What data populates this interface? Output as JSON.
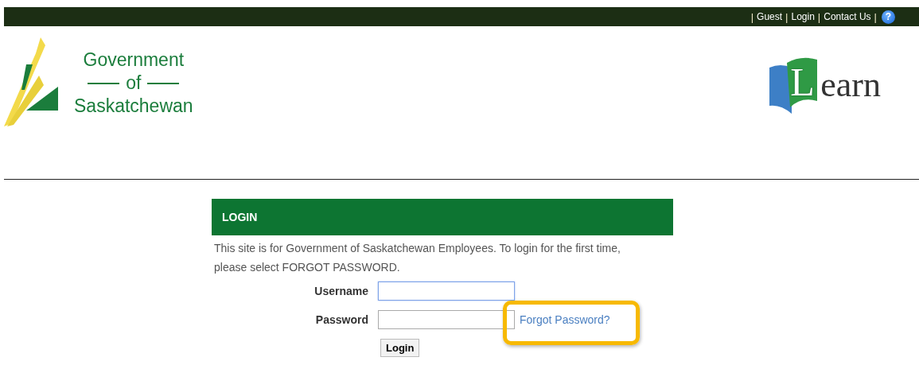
{
  "top_bar": {
    "nav": [
      {
        "kind": "separator",
        "text": "|"
      },
      {
        "kind": "link",
        "text": "Guest"
      },
      {
        "kind": "separator",
        "text": "|"
      },
      {
        "kind": "link",
        "text": "Login"
      },
      {
        "kind": "separator",
        "text": "|"
      },
      {
        "kind": "link",
        "text": "Contact Us"
      },
      {
        "kind": "separator",
        "text": "|"
      },
      {
        "kind": "help",
        "text": "?"
      }
    ]
  },
  "logo": {
    "line_1": "Government",
    "line_2": "of",
    "line_3": "Saskatchewan"
  },
  "learn_logo": {
    "initial": "L",
    "rest": "earn"
  },
  "login_panel": {
    "title": "LOGIN",
    "intro": "This site is for Government of Saskatchewan Employees. To login for the first time, please select FORGOT PASSWORD.",
    "fields": [
      {
        "label": "Username",
        "focused": true
      },
      {
        "label": "Password",
        "focused": false,
        "link": "Forgot Password?"
      }
    ],
    "button": "Login",
    "highlight": true
  }
}
